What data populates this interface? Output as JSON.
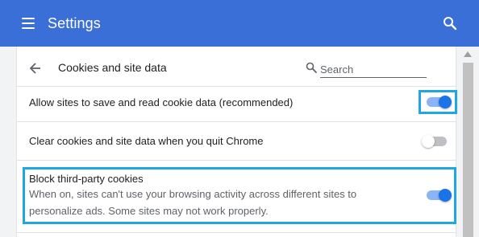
{
  "header": {
    "title": "Settings",
    "menu_icon": "hamburger-menu-icon",
    "search_icon": "search-icon",
    "color": "#3b6fd8"
  },
  "subpage": {
    "title": "Cookies and site data",
    "back_icon": "arrow-back-icon",
    "search_placeholder": "Search"
  },
  "settings": [
    {
      "label": "Allow sites to save and read cookie data (recommended)",
      "enabled": true
    },
    {
      "label": "Clear cookies and site data when you quit Chrome",
      "enabled": false
    },
    {
      "label": "Block third-party cookies",
      "description_line1": "When on, sites can't use your browsing activity across different sites to",
      "description_line2": "personalize ads. Some sites may not work properly.",
      "enabled": true
    }
  ],
  "colors": {
    "toggle_on": "#1a73e8",
    "highlight": "#1ea7e1"
  }
}
